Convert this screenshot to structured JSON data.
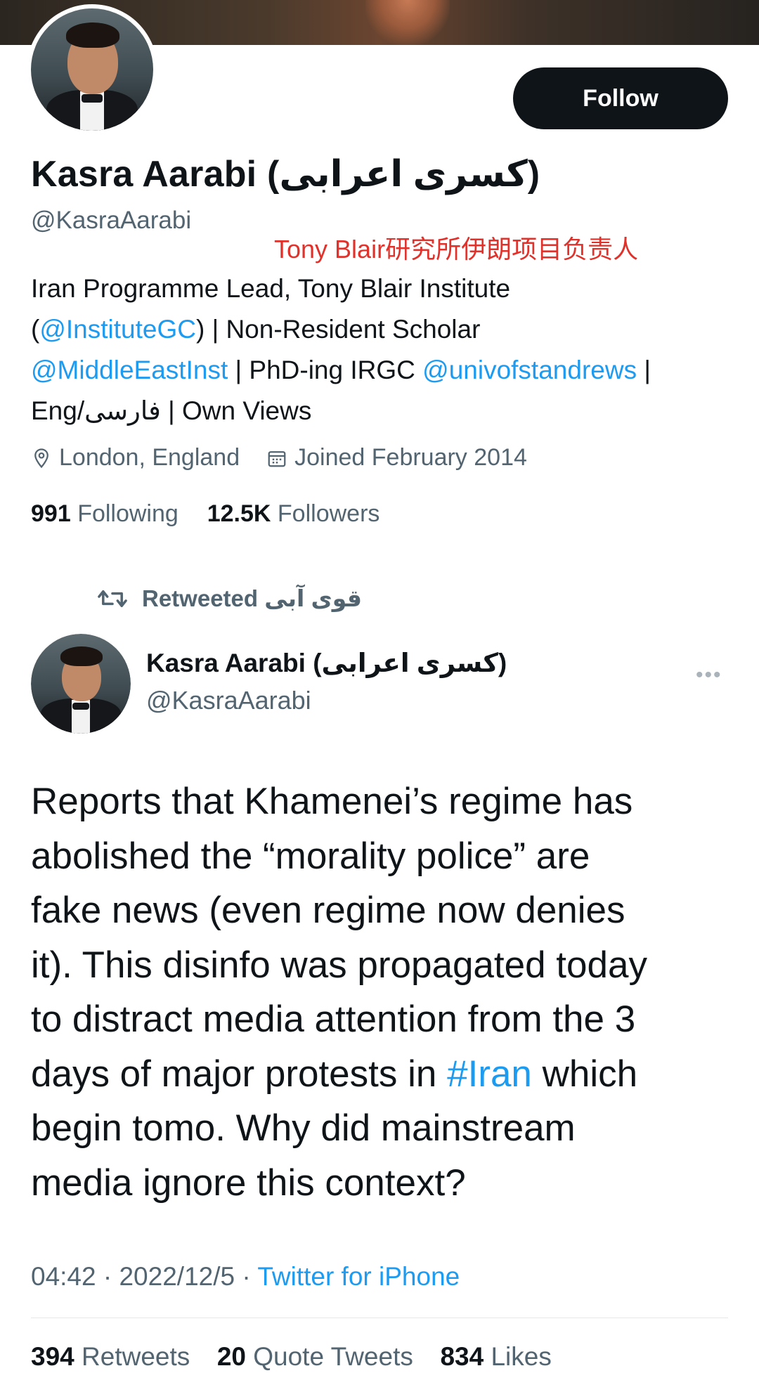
{
  "profile": {
    "name": "Kasra Aarabi (کسری اعرابی)",
    "handle": "@KasraAarabi",
    "follow_label": "Follow",
    "annotation": "Tony Blair研究所伊朗项目负责人",
    "bio": {
      "line1": "Iran Programme Lead, Tony Blair Institute",
      "line2_pre": "(",
      "line2_link": "@InstituteGC",
      "line2_post": ") | Non-Resident Scholar",
      "line3_link1": "@MiddleEastInst",
      "line3_mid": " | PhD-ing IRGC ",
      "line3_link2": "@univofstandrews",
      "line3_post": " |",
      "line4": "Eng/فارسی | Own Views"
    },
    "location": "London, England",
    "joined": "Joined February 2014",
    "following_count": "991",
    "following_label": "Following",
    "followers_count": "12.5K",
    "followers_label": "Followers"
  },
  "tweet": {
    "retweeted_by": "قوی آبی",
    "retweeted_label": "Retweeted",
    "author_name": "Kasra Aarabi (کسری اعرابی)",
    "author_handle": "@KasraAarabi",
    "more_label": "•••",
    "text_lines": {
      "l1": "Reports that Khamenei’s regime has",
      "l2": "abolished the “morality police” are",
      "l3": "fake news (even regime now denies",
      "l4": "it). This disinfo was propagated today",
      "l5": "to distract media attention from the 3",
      "l6_pre": "days of major protests in ",
      "l6_tag": "#Iran",
      "l6_post": " which",
      "l7": "begin tomo. Why did mainstream",
      "l8": "media ignore this context?"
    },
    "time": "04:42",
    "date": "2022/12/5",
    "source": "Twitter for iPhone",
    "retweets_count": "394",
    "retweets_label": "Retweets",
    "quotes_count": "20",
    "quotes_label": "Quote Tweets",
    "likes_count": "834",
    "likes_label": "Likes"
  },
  "colors": {
    "link": "#1d9bf0",
    "muted": "#536471",
    "annotation": "#e0312b"
  }
}
